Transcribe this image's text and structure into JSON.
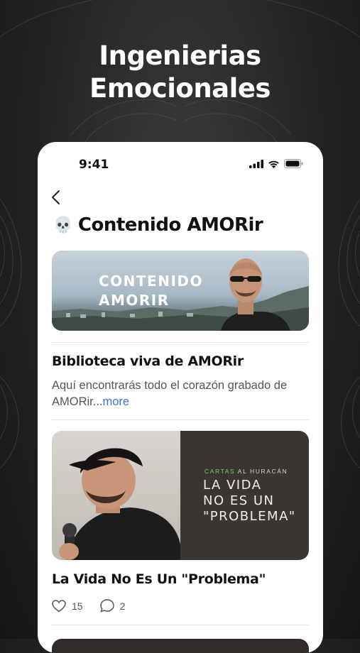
{
  "headline": {
    "line1": "Ingenierias",
    "line2": "Emocionales"
  },
  "status": {
    "time": "9:41"
  },
  "page": {
    "icon": "skull-icon",
    "title": "Contenido AMORir"
  },
  "banner": {
    "line1": "CONTENIDO",
    "line2": "AMORIR"
  },
  "post1": {
    "title": "Biblioteca viva de AMORir",
    "description": "Aquí encontrarás todo el corazón grabado de AMORir...",
    "more": "more"
  },
  "post2": {
    "image": {
      "kicker_a": "CARTAS",
      "kicker_b": "AL HURACÁN",
      "line1": "LA VIDA",
      "line2": "NO ES UN",
      "line3": "\"PROBLEMA\""
    },
    "title": "La Vida No Es Un \"Problema\"",
    "likes": "15",
    "comments": "2"
  }
}
